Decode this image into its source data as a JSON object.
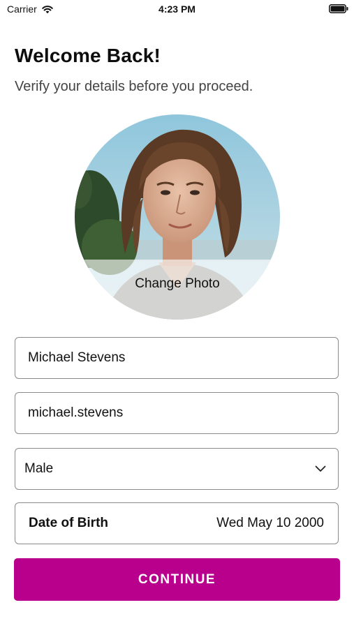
{
  "status_bar": {
    "carrier": "Carrier",
    "time": "4:23 PM",
    "wifi_icon": "wifi-icon",
    "battery_icon": "battery-icon"
  },
  "header": {
    "title": "Welcome Back!",
    "subtitle": "Verify your details before you proceed."
  },
  "avatar": {
    "change_photo_label": "Change Photo"
  },
  "form": {
    "full_name": "Michael Stevens",
    "username": "michael.stevens",
    "gender": {
      "selected": "Male",
      "icon": "chevron-down-icon"
    },
    "date_of_birth": {
      "label": "Date of Birth",
      "value": "Wed May 10 2000"
    }
  },
  "actions": {
    "continue_label": "CONTINUE"
  },
  "colors": {
    "accent": "#b8008c",
    "border": "#8a8a8a",
    "text": "#111111",
    "subtitle": "#444444"
  }
}
